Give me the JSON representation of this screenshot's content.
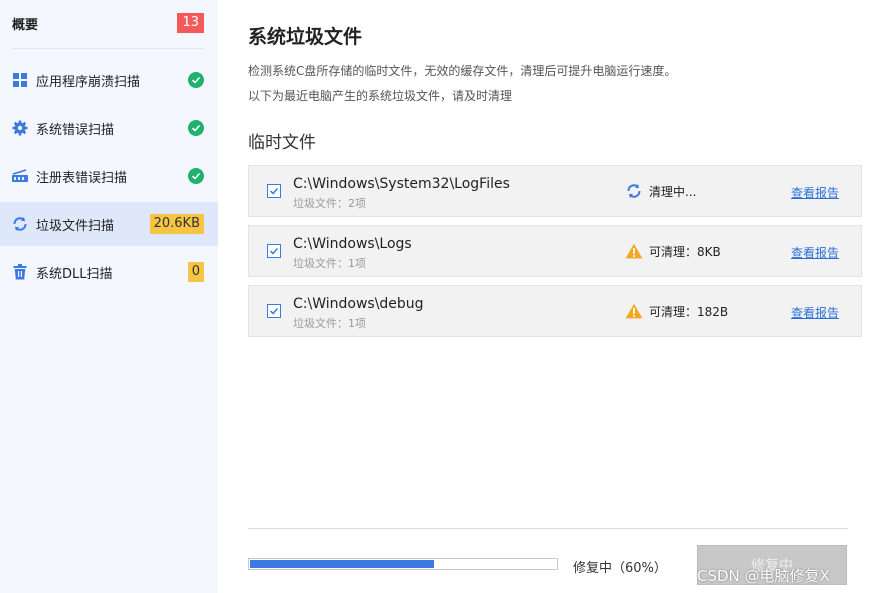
{
  "sidebar": {
    "overview": {
      "label": "概要",
      "badge": "13"
    },
    "items": [
      {
        "label": "应用程序崩溃扫描",
        "icon": "grid-icon",
        "state": "done"
      },
      {
        "label": "系统错误扫描",
        "icon": "gear-icon",
        "state": "done"
      },
      {
        "label": "注册表错误扫描",
        "icon": "registry-icon",
        "state": "done"
      },
      {
        "label": "垃圾文件扫描",
        "icon": "refresh-icon",
        "state": "active",
        "badge": "20.6KB"
      },
      {
        "label": "系统DLL扫描",
        "icon": "trash-icon",
        "state": "pending",
        "badge": "0"
      }
    ]
  },
  "main": {
    "title": "系统垃圾文件",
    "desc1": "检测系统C盘所存储的临时文件，无效的缓存文件，清理后可提升电脑运行速度。",
    "desc2": "以下为最近电脑产生的系统垃圾文件，请及时清理",
    "section_title": "临时文件",
    "rows": [
      {
        "path": "C:\\Windows\\System32\\LogFiles",
        "sub": "垃圾文件：2项",
        "status": "清理中...",
        "status_icon": "spinner-icon",
        "link": "查看报告"
      },
      {
        "path": "C:\\Windows\\Logs",
        "sub": "垃圾文件：1项",
        "status": "可清理：8KB",
        "status_icon": "warning-icon",
        "link": "查看报告"
      },
      {
        "path": "C:\\Windows\\debug",
        "sub": "垃圾文件：1项",
        "status": "可清理：182B",
        "status_icon": "warning-icon",
        "link": "查看报告"
      }
    ]
  },
  "footer": {
    "progress": 0.6,
    "progress_text": "修复中（60%）",
    "button_label": "修复中"
  },
  "watermark": "CSDN @电脑修复X",
  "colors": {
    "accent": "#3b7ae0",
    "success": "#1fb36b",
    "warning": "#f5a623",
    "danger": "#f35a5a",
    "highlight": "#f7c544"
  }
}
